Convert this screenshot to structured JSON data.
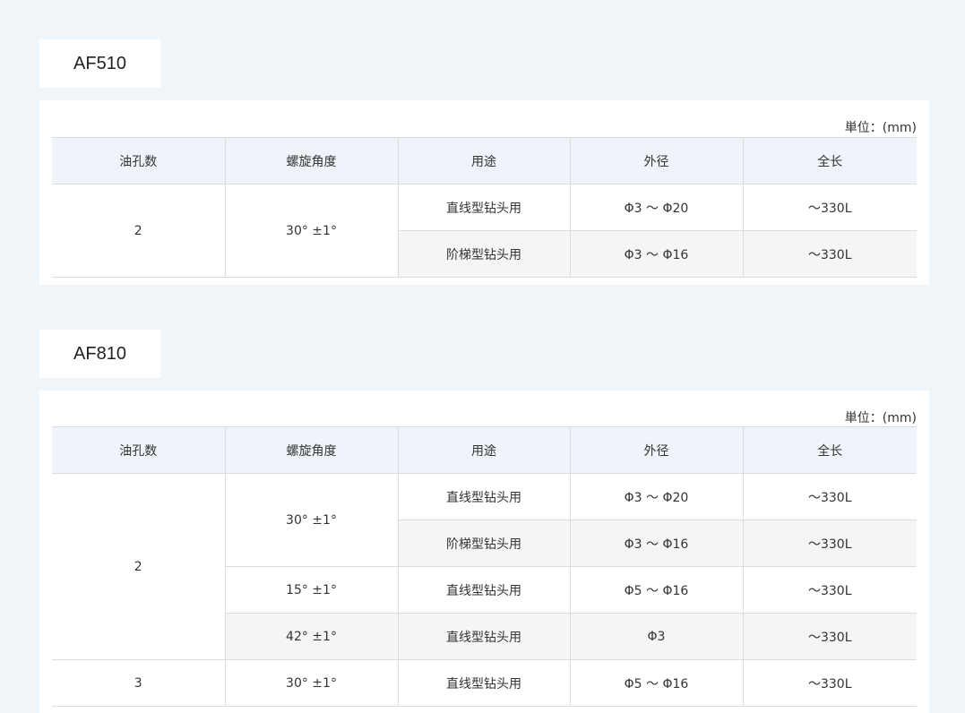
{
  "unit_label": "単位：(mm)",
  "headers": [
    "油孔数",
    "螺旋角度",
    "用途",
    "外径",
    "全长"
  ],
  "af510": {
    "model": "AF510",
    "rows": [
      {
        "holes": "2",
        "angle": "30° ±1°",
        "use": "直线型钻头用",
        "diameter": "Φ3 ～ Φ20",
        "length": "～330L"
      },
      {
        "use": "阶梯型钻头用",
        "diameter": "Φ3 ～ Φ16",
        "length": "～330L"
      }
    ]
  },
  "af810": {
    "model": "AF810",
    "rows": [
      {
        "holes": "2",
        "angle": "30° ±1°",
        "use": "直线型钻头用",
        "diameter": "Φ3 ～ Φ20",
        "length": "～330L"
      },
      {
        "use": "阶梯型钻头用",
        "diameter": "Φ3 ～ Φ16",
        "length": "～330L"
      },
      {
        "angle": "15° ±1°",
        "use": "直线型钻头用",
        "diameter": "Φ5 ～ Φ16",
        "length": "～330L"
      },
      {
        "angle": "42° ±1°",
        "use": "直线型钻头用",
        "diameter": "Φ3",
        "length": "～330L"
      },
      {
        "holes": "3",
        "angle": "30° ±1°",
        "use": "直线型钻头用",
        "diameter": "Φ5 ～ Φ16",
        "length": "～330L"
      }
    ]
  }
}
